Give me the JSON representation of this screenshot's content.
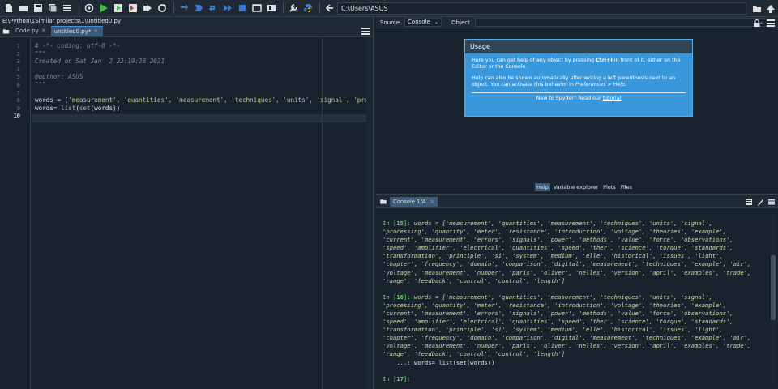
{
  "toolbar": {
    "path": "C:\\Users\\ASUS",
    "icons": [
      "new-file-icon",
      "open-file-icon",
      "save-icon",
      "save-all-icon",
      "list-icon",
      "at-icon",
      "run-icon",
      "run-cell-icon",
      "run-cell-advance-icon",
      "run-selection-icon",
      "re-run-icon",
      "debug-step-icon",
      "debug-into-icon",
      "debug-return-icon",
      "debug-continue-icon",
      "stop-icon",
      "maximize-icon",
      "preferences-icon",
      "wrench-icon",
      "python-icon",
      "back-arrow-icon",
      "forward-arrow-icon"
    ]
  },
  "editor": {
    "file_path": "E:\\Python\\1Similar projects\\1\\untitled0.py",
    "tabs": [
      {
        "label": "Code.py",
        "active": false
      },
      {
        "label": "untitled0.py*",
        "active": true
      }
    ],
    "line_numbers": [
      "1",
      "2",
      "3",
      "4",
      "5",
      "6",
      "7",
      "8",
      "9",
      "10"
    ],
    "current_line": "10",
    "lines": {
      "l1": "# -*- coding: utf-8 -*-",
      "l2": "\"\"\"",
      "l3": "Created on Sat Jan  2 22:19:28 2021",
      "l5": "@author: ASUS",
      "l6": "\"\"\"",
      "l8_a": "words = [",
      "l8_b": "'measurement', 'quantities', 'measurement', 'techniques', 'units', 'signal', 'proc",
      "l9_a": "words= ",
      "l9_b": "list",
      "l9_c": "(",
      "l9_d": "set",
      "l9_e": "(words))"
    }
  },
  "help": {
    "source_label": "Source",
    "source_value": "Console",
    "object_label": "Object",
    "usage_title": "Usage",
    "p1_a": "Here you can get help of any object by pressing ",
    "p1_b": "Ctrl+I",
    "p1_c": " in front of it, either on the Editor or the Console.",
    "p2_a": "Help can also be shown automatically after writing a left parenthesis next to an object. You can activate this behavior in ",
    "p2_b": "Preferences > Help",
    "p2_c": ".",
    "foot_a": "New to Spyder? Read our ",
    "foot_link": "tutorial",
    "tabs": [
      "Help",
      "Variable explorer",
      "Plots",
      "Files"
    ]
  },
  "console": {
    "tab_label": "Console 1/A",
    "block1_prompt": "In [",
    "block1_num": "15",
    "block1_close": "]:",
    "block1_lines": [
      " words = ['measurement', 'quantities', 'measurement', 'techniques', 'units', 'signal',",
      "'processing', 'quantity', 'meter', 'resistance', 'introduction', 'voltage', 'theories', 'example',",
      "'current', 'measurement', 'errors', 'signals', 'power', 'methods', 'value', 'force', 'observations',",
      "'speed', 'amplifier', 'electrical', 'quantities', 'speed', 'ther', 'science', 'torque', 'standards',",
      "'transformation', 'principle', 'si', 'system', 'medium', 'elle', 'historical', 'issues', 'light',",
      "'chapter', 'frequency', 'domain', 'comparison', 'digital', 'measurement', 'techniques', 'example', 'air',",
      "'voltage', 'measurement', 'number', 'paris', 'oliver', 'nelles', 'version', 'april', 'examples', 'trade',",
      "'range', 'feedback', 'control', 'control', 'length']"
    ],
    "block2_num": "16",
    "block2_lines": [
      " words = ['measurement', 'quantities', 'measurement', 'techniques', 'units', 'signal',",
      "'processing', 'quantity', 'meter', 'resistance', 'introduction', 'voltage', 'theories', 'example',",
      "'current', 'measurement', 'errors', 'signals', 'power', 'methods', 'value', 'force', 'observations',",
      "'speed', 'amplifier', 'electrical', 'quantities', 'speed', 'ther', 'science', 'torque', 'standards',",
      "'transformation', 'principle', 'si', 'system', 'medium', 'elle', 'historical', 'issues', 'light',",
      "'chapter', 'frequency', 'domain', 'comparison', 'digital', 'measurement', 'techniques', 'example', 'air',",
      "'voltage', 'measurement', 'number', 'paris', 'oliver', 'nelles', 'version', 'april', 'examples', 'trade',",
      "'range', 'feedback', 'control', 'control', 'length']",
      "    ...: words= list(set(words))"
    ],
    "block3_num": "17"
  },
  "colors": {
    "background": "#19232d",
    "panel": "#1f2a35",
    "accent": "#3898db",
    "prompt_green": "#70d070"
  }
}
